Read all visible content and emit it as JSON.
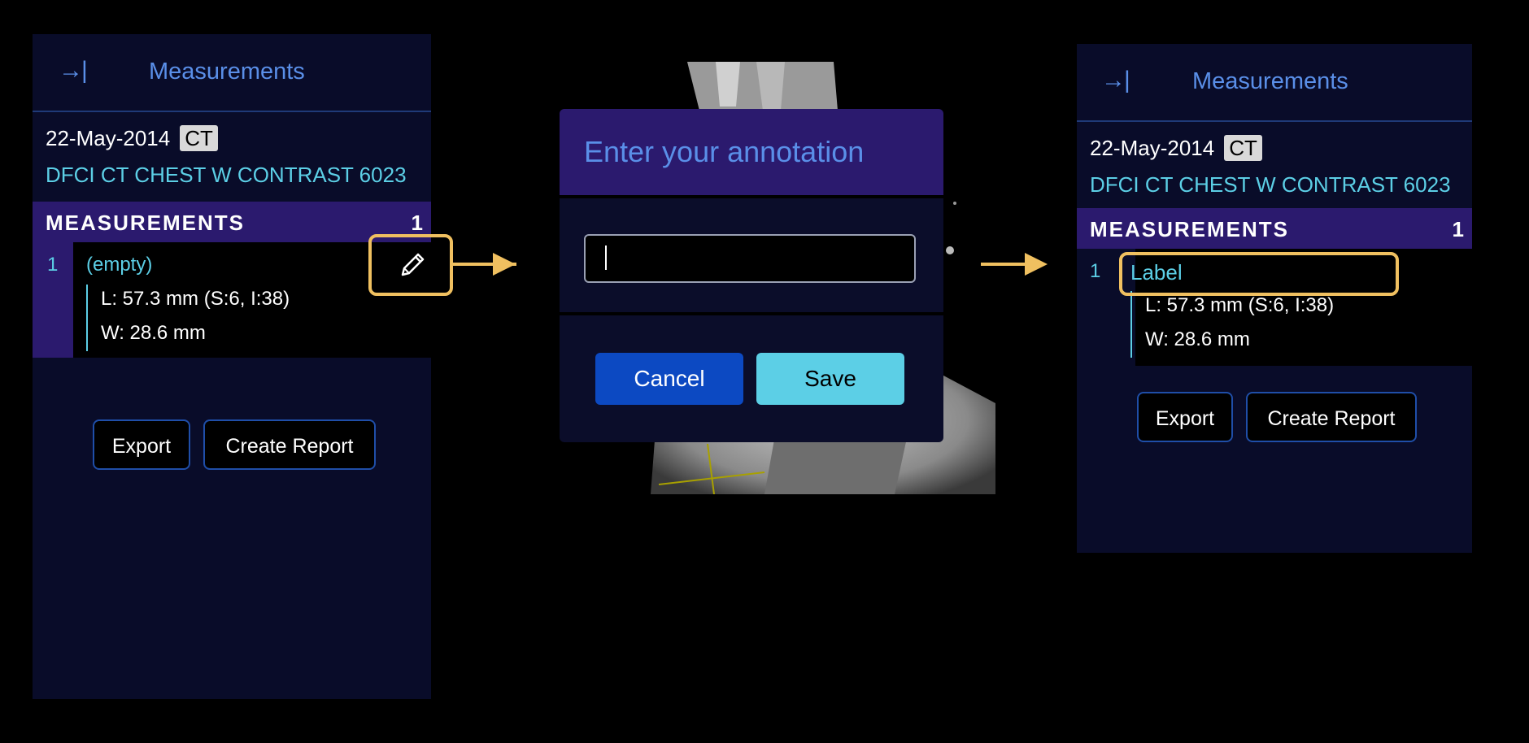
{
  "left_panel": {
    "collapse_icon": "→|",
    "title": "Measurements",
    "study_date": "22-May-2014",
    "modality": "CT",
    "study_description": "DFCI CT CHEST W CONTRAST 6023",
    "section_title": "MEASUREMENTS",
    "section_count": "1",
    "measurement": {
      "index": "1",
      "label": "(empty)",
      "length": "L: 57.3 mm (S:6, I:38)",
      "width": "W: 28.6 mm"
    },
    "export_label": "Export",
    "create_report_label": "Create Report",
    "edit_icon": "pencil-icon"
  },
  "dialog": {
    "title": "Enter your annotation",
    "input_value": "",
    "cancel_label": "Cancel",
    "save_label": "Save"
  },
  "right_panel": {
    "collapse_icon": "→|",
    "title": "Measurements",
    "study_date": "22-May-2014",
    "modality": "CT",
    "study_description": "DFCI CT CHEST W CONTRAST 6023",
    "section_title": "MEASUREMENTS",
    "section_count": "1",
    "measurement": {
      "index": "1",
      "label": "Label",
      "length": "L: 57.3 mm (S:6, I:38)",
      "width": "W: 28.6 mm"
    },
    "export_label": "Export",
    "create_report_label": "Create Report"
  },
  "colors": {
    "panel_bg": "#090c29",
    "accent_purple": "#2b1a6e",
    "accent_blue": "#5a8fe8",
    "accent_cyan": "#5ccfe6",
    "highlight": "#f0c060",
    "cancel_bg": "#0c49c2"
  }
}
